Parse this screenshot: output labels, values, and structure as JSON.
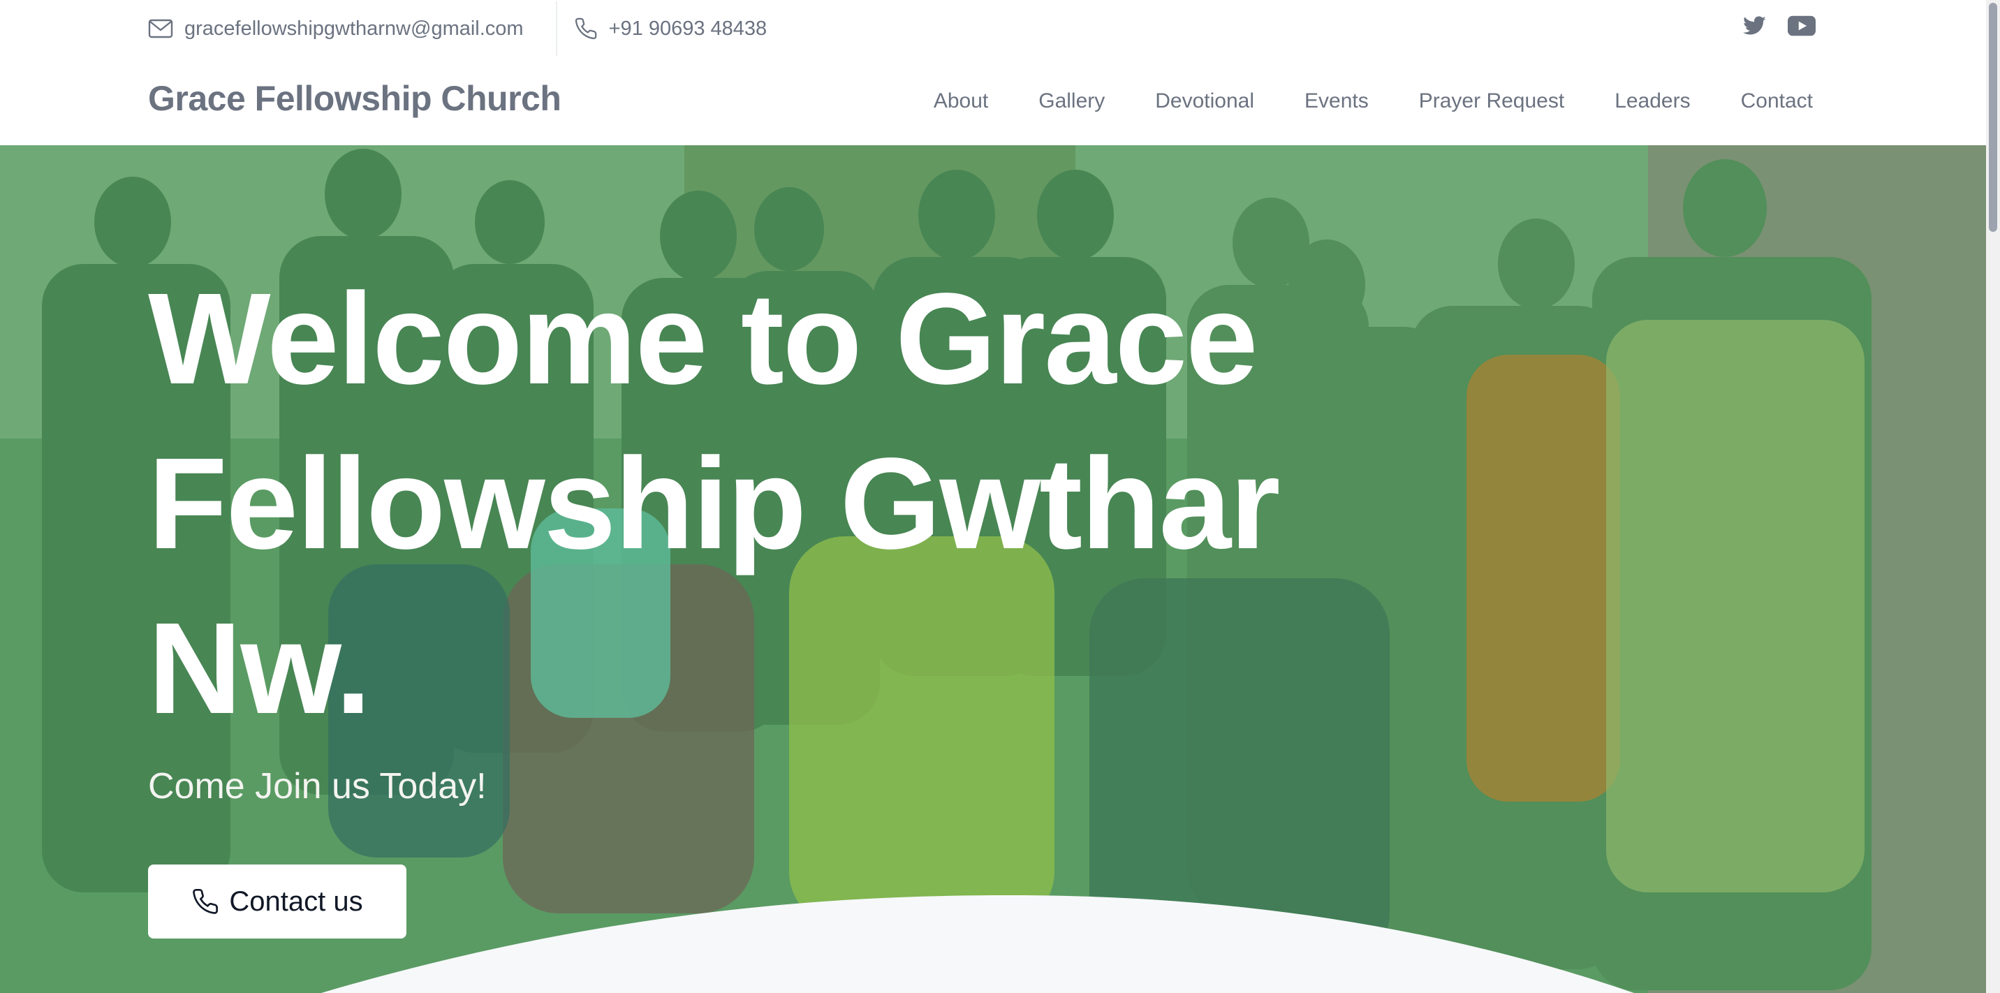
{
  "topbar": {
    "email": "gracefellowshipgwtharnw@gmail.com",
    "phone": "+91 90693 48438",
    "social": [
      "twitter-icon",
      "youtube-icon"
    ]
  },
  "navbar": {
    "brand": "Grace Fellowship Church",
    "items": [
      "About",
      "Gallery",
      "Devotional",
      "Events",
      "Prayer Request",
      "Leaders",
      "Contact"
    ]
  },
  "hero": {
    "title": "Welcome to Grace Fellowship Gwthar Nw.",
    "subtitle": "Come Join us Today!",
    "cta_label": "Contact us",
    "cta_icon": "phone-icon"
  },
  "colors": {
    "overlay": "#3c9650",
    "text_muted": "#6b7280",
    "wave": "#f7f8fa"
  }
}
